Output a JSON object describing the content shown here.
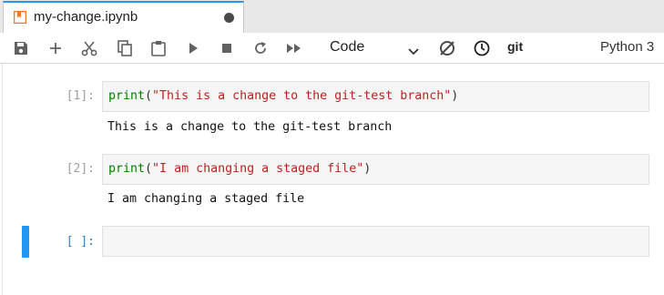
{
  "tab": {
    "title": "my-change.ipynb",
    "icon": "notebook-icon",
    "dirty_icon": "unsaved-dot-icon",
    "accent_color": "#2196f3"
  },
  "toolbar": {
    "buttons": [
      {
        "icon": "save-icon"
      },
      {
        "icon": "plus-icon"
      },
      {
        "icon": "scissors-icon"
      },
      {
        "icon": "copy-icon"
      },
      {
        "icon": "paste-icon"
      },
      {
        "icon": "play-icon"
      },
      {
        "icon": "stop-icon"
      },
      {
        "icon": "restart-icon"
      },
      {
        "icon": "fast-forward-icon"
      }
    ],
    "cell_type": "Code",
    "git_label": "git",
    "kernel": "Python 3",
    "trailing_icons": [
      "git-diff-icon",
      "clock-icon"
    ]
  },
  "cells": [
    {
      "prompt": "[1]:",
      "code": {
        "builtin": "print",
        "open": "(",
        "string": "\"This is a change to the git-test branch\"",
        "close": ")"
      },
      "output": "This is a change to the git-test branch"
    },
    {
      "prompt": "[2]:",
      "code": {
        "builtin": "print",
        "open": "(",
        "string": "\"I am changing a staged file\"",
        "close": ")"
      },
      "output": "I am changing a staged file"
    },
    {
      "prompt": "[ ]:",
      "code": {
        "builtin": "",
        "open": "",
        "string": "",
        "close": ""
      },
      "output": ""
    }
  ],
  "colors": {
    "prompt_active": "#307fc1",
    "string": "#ba2121",
    "builtin": "#008000",
    "active_cell_bar": "#2196f3"
  }
}
